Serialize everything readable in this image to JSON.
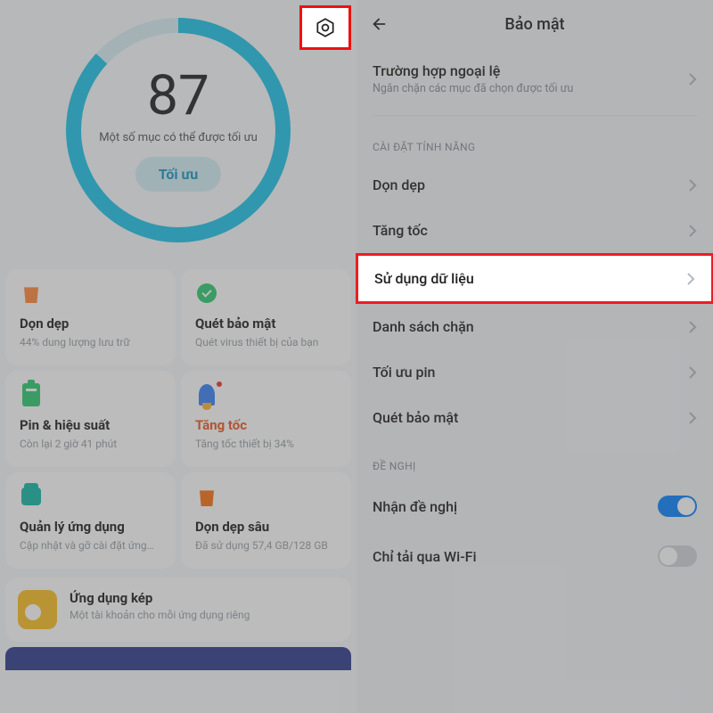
{
  "left": {
    "score": "87",
    "score_sub": "Một số mục có thể được tối ưu",
    "optimize_btn": "Tối ưu",
    "tiles": [
      {
        "title": "Dọn dẹp",
        "sub": "44% dung lượng lưu trữ"
      },
      {
        "title": "Quét bảo mật",
        "sub": "Quét virus thiết bị của bạn"
      },
      {
        "title": "Pin & hiệu suất",
        "sub": "Còn lại 2 giờ 41 phút"
      },
      {
        "title": "Tăng tốc",
        "sub": "Tăng tốc thiết bị 34%"
      },
      {
        "title": "Quản lý ứng dụng",
        "sub": "Cập nhật và gỡ cài đặt ứng…"
      },
      {
        "title": "Dọn dẹp sâu",
        "sub": "Đã sử dụng 57,4 GB/128 GB"
      }
    ],
    "banner": {
      "title": "Ứng dụng kép",
      "sub": "Một tài khoản cho mỗi ứng dụng riêng"
    }
  },
  "right": {
    "title": "Bảo mật",
    "exception": {
      "title": "Trường hợp ngoại lệ",
      "sub": "Ngăn chặn các mục đã chọn được tối ưu"
    },
    "section_features": "CÀI ĐẶT TÍNH NĂNG",
    "items": [
      {
        "label": "Dọn dẹp"
      },
      {
        "label": "Tăng tốc"
      },
      {
        "label": "Sử dụng dữ liệu"
      },
      {
        "label": "Danh sách chặn"
      },
      {
        "label": "Tối ưu pin"
      },
      {
        "label": "Quét bảo mật"
      }
    ],
    "section_suggest": "ĐỀ NGHỊ",
    "toggles": [
      {
        "label": "Nhận đề nghị",
        "on": true
      },
      {
        "label": "Chỉ tải qua Wi-Fi",
        "on": false
      }
    ]
  }
}
